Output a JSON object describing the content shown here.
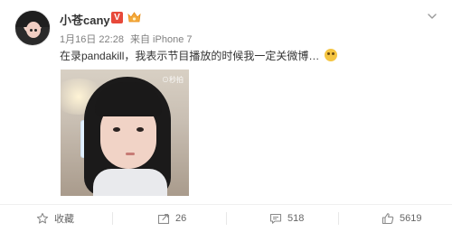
{
  "post": {
    "user": {
      "name": "小苍cany",
      "verified_badge": "V"
    },
    "meta": {
      "time": "1月16日 22:28",
      "source": "来自 iPhone 7"
    },
    "text": "在录pandakill，我表示节目播放的时候我一定关微博…",
    "photo": {
      "watermark": "⊙秒拍"
    }
  },
  "actions": {
    "favorite": {
      "label": "收藏"
    },
    "repost": {
      "count": "26"
    },
    "comment": {
      "count": "518"
    },
    "like": {
      "count": "5619"
    }
  },
  "colors": {
    "verified_badge": "#e7493a",
    "text_primary": "#333333",
    "text_meta": "#808080"
  }
}
